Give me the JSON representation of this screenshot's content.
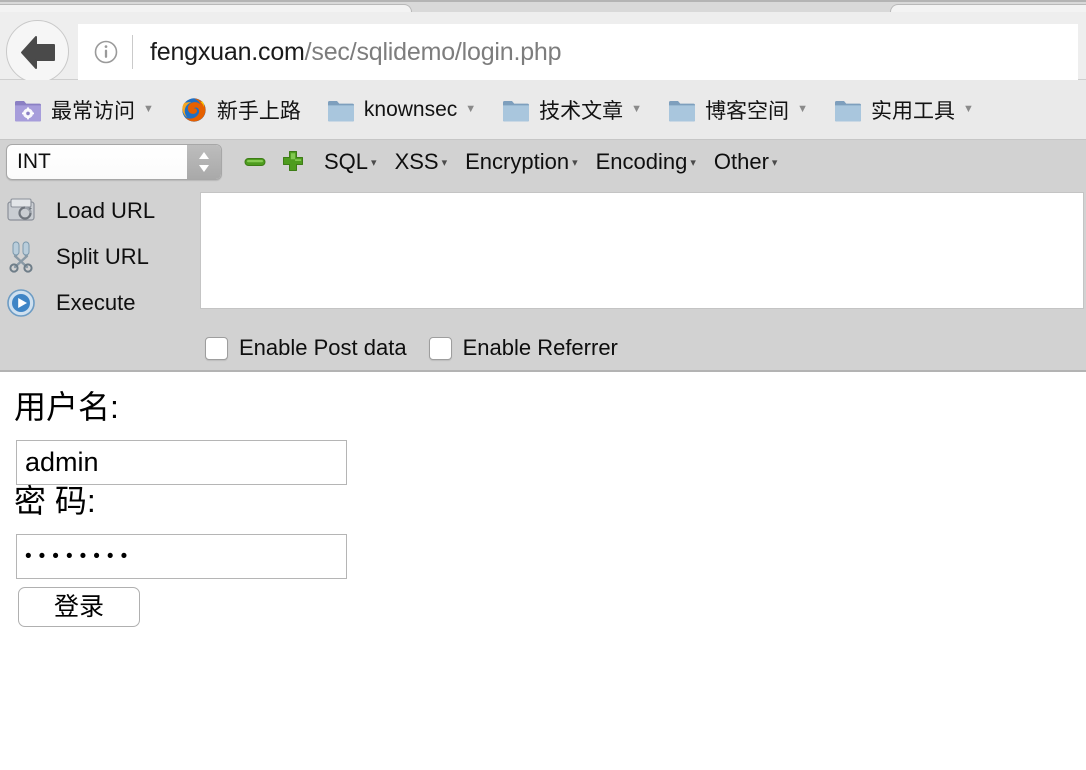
{
  "browser": {
    "back_button": "back-arrow-icon",
    "info_icon": "info-icon",
    "url": {
      "host": "fengxuan.com",
      "path": "/sec/sqlidemo/login.php"
    },
    "bookmarks": [
      {
        "label": "最常访问",
        "icon": "folder-gear-icon",
        "has_arrow": true
      },
      {
        "label": "新手上路",
        "icon": "firefox-icon",
        "has_arrow": false
      },
      {
        "label": "knownsec",
        "icon": "folder-icon",
        "has_arrow": true
      },
      {
        "label": "技术文章",
        "icon": "folder-icon",
        "has_arrow": true
      },
      {
        "label": "博客空间",
        "icon": "folder-icon",
        "has_arrow": true
      },
      {
        "label": "实用工具",
        "icon": "folder-icon",
        "has_arrow": true
      }
    ]
  },
  "hackbar": {
    "type_select": {
      "value": "INT",
      "stepper_icon": "updown-stepper-icon"
    },
    "minus_icon": "minus-icon",
    "plus_icon": "plus-icon",
    "menus": [
      {
        "label": "SQL",
        "arrow": "▾"
      },
      {
        "label": "XSS",
        "arrow": "▾"
      },
      {
        "label": "Encryption",
        "arrow": "▾"
      },
      {
        "label": "Encoding",
        "arrow": "▾"
      },
      {
        "label": "Other",
        "arrow": "▾"
      }
    ],
    "actions": [
      {
        "label": "Load URL",
        "icon": "load-url-icon"
      },
      {
        "label": "Split URL",
        "icon": "split-url-icon"
      },
      {
        "label": "Execute",
        "icon": "execute-icon"
      }
    ],
    "textarea_value": "",
    "checkboxes": [
      {
        "label": "Enable Post data",
        "checked": false
      },
      {
        "label": "Enable Referrer",
        "checked": false
      }
    ]
  },
  "login_form": {
    "username_label": "用户名:",
    "username_value": "admin",
    "password_label": "密 码:",
    "password_value": "••••••••",
    "submit_label": "登录"
  },
  "colors": {
    "chrome_bg": "#eeeeee",
    "bookmarks_bg": "#eaeaea",
    "hackbar_bg": "#d2d2d2",
    "page_bg": "#ffffff",
    "accent_green": "#57a72b",
    "accent_blue": "#3f85c6"
  }
}
